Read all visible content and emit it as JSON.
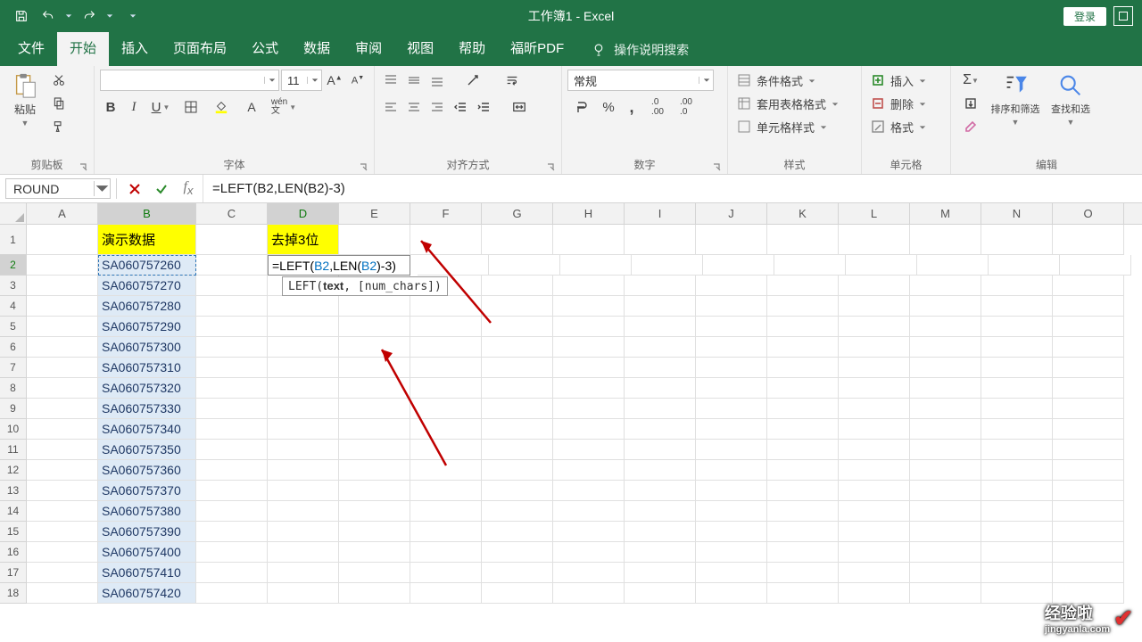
{
  "app": {
    "title": "工作簿1  -  Excel",
    "login": "登录"
  },
  "tabs": {
    "file": "文件",
    "home": "开始",
    "insert": "插入",
    "layout": "页面布局",
    "formulas": "公式",
    "data": "数据",
    "review": "审阅",
    "view": "视图",
    "help": "帮助",
    "foxit": "福昕PDF",
    "tellme": "操作说明搜索"
  },
  "ribbon": {
    "clipboard": {
      "paste": "粘贴",
      "label": "剪贴板"
    },
    "font": {
      "size": "11",
      "label": "字体"
    },
    "align": {
      "label": "对齐方式"
    },
    "number": {
      "format": "常规",
      "label": "数字"
    },
    "styles": {
      "cond": "条件格式",
      "table": "套用表格格式",
      "cell": "单元格样式",
      "label": "样式"
    },
    "cells": {
      "insert": "插入",
      "delete": "删除",
      "format": "格式",
      "label": "单元格"
    },
    "editing": {
      "sort": "排序和筛选",
      "find": "查找和选",
      "label": "编辑"
    }
  },
  "formula_bar": {
    "name": "ROUND",
    "formula": "=LEFT(B2,LEN(B2)-3)"
  },
  "columns": [
    "A",
    "B",
    "C",
    "D",
    "E",
    "F",
    "G",
    "H",
    "I",
    "J",
    "K",
    "L",
    "M",
    "N",
    "O"
  ],
  "headers": {
    "b1": "演示数据",
    "d1": "去掉3位"
  },
  "cell_formula": "=LEFT(B2,LEN(B2)-3)",
  "tooltip": "LEFT(text, [num_chars])",
  "data_rows": [
    "SA060757260",
    "SA060757270",
    "SA060757280",
    "SA060757290",
    "SA060757300",
    "SA060757310",
    "SA060757320",
    "SA060757330",
    "SA060757340",
    "SA060757350",
    "SA060757360",
    "SA060757370",
    "SA060757380",
    "SA060757390",
    "SA060757400",
    "SA060757410",
    "SA060757420"
  ],
  "watermark": {
    "top": "经验啦",
    "sub": "jingyanla.com"
  }
}
